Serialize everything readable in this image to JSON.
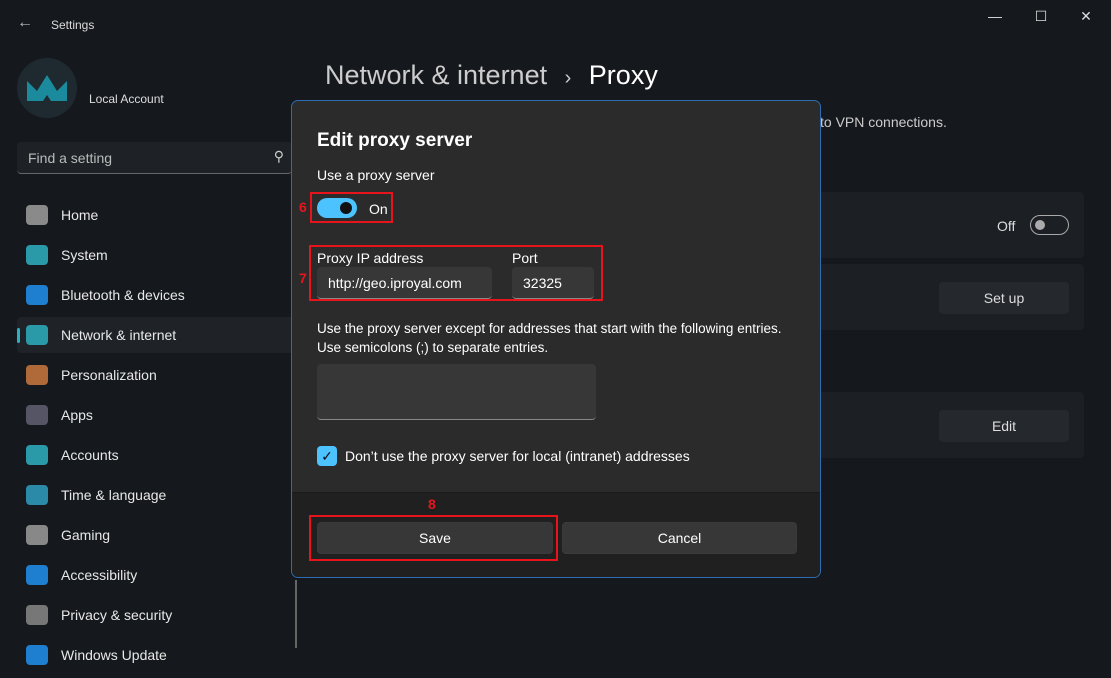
{
  "window": {
    "title": "Settings",
    "minimize": "—",
    "maximize": "☐",
    "close": "✕"
  },
  "account": {
    "name": "Local Account"
  },
  "search": {
    "placeholder": "Find a setting"
  },
  "sidebar": {
    "items": [
      {
        "label": "Home",
        "icon": "home-icon",
        "color": "#8a8a8a"
      },
      {
        "label": "System",
        "icon": "system-icon",
        "color": "#2a9aa8"
      },
      {
        "label": "Bluetooth & devices",
        "icon": "bluetooth-icon",
        "color": "#1e7fd0"
      },
      {
        "label": "Network & internet",
        "icon": "wifi-icon",
        "color": "#2a9aa8",
        "selected": true
      },
      {
        "label": "Personalization",
        "icon": "brush-icon",
        "color": "#b06a3a"
      },
      {
        "label": "Apps",
        "icon": "apps-icon",
        "color": "#556"
      },
      {
        "label": "Accounts",
        "icon": "person-icon",
        "color": "#2a9aa8"
      },
      {
        "label": "Time & language",
        "icon": "clock-globe-icon",
        "color": "#2a8aa8"
      },
      {
        "label": "Gaming",
        "icon": "gamepad-icon",
        "color": "#888"
      },
      {
        "label": "Accessibility",
        "icon": "accessibility-icon",
        "color": "#1e7fd0"
      },
      {
        "label": "Privacy & security",
        "icon": "shield-icon",
        "color": "#777"
      },
      {
        "label": "Windows Update",
        "icon": "update-icon",
        "color": "#1e7fd0"
      }
    ]
  },
  "page": {
    "breadcrumb_parent": "Network & internet",
    "separator": "›",
    "title": "Proxy",
    "subtitle_visible": "to VPN connections."
  },
  "cards": {
    "auto_toggle_state": "Off",
    "setup_button": "Set up",
    "edit_button": "Edit"
  },
  "dialog": {
    "title": "Edit proxy server",
    "use_proxy_label": "Use a proxy server",
    "use_proxy_state": "On",
    "ip_label": "Proxy IP address",
    "ip_value": "http://geo.iproyal.com",
    "port_label": "Port",
    "port_value": "32325",
    "exceptions_text1": "Use the proxy server except for addresses that start with the following entries.",
    "exceptions_text2": "Use semicolons (;) to separate entries.",
    "exceptions_value": "",
    "local_checkbox_label": "Don’t use the proxy server for local (intranet) addresses",
    "local_checked": true,
    "save": "Save",
    "cancel": "Cancel"
  },
  "annotations": {
    "step6": "6",
    "step7": "7",
    "step8": "8",
    "color": "#e8141c"
  },
  "accent": "#4cc2ff"
}
